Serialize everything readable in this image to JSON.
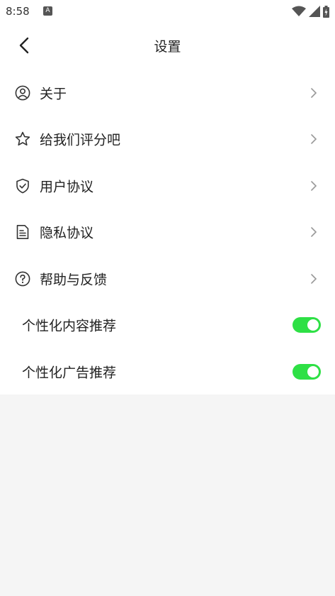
{
  "status_bar": {
    "time": "8:58",
    "notification_icon": "A"
  },
  "header": {
    "title": "设置"
  },
  "settings": {
    "items": [
      {
        "label": "关于",
        "icon": "person-circle-icon"
      },
      {
        "label": "给我们评分吧",
        "icon": "star-icon"
      },
      {
        "label": "用户协议",
        "icon": "shield-check-icon"
      },
      {
        "label": "隐私协议",
        "icon": "document-icon"
      },
      {
        "label": "帮助与反馈",
        "icon": "question-circle-icon"
      }
    ],
    "toggles": [
      {
        "label": "个性化内容推荐",
        "on": true
      },
      {
        "label": "个性化广告推荐",
        "on": true
      }
    ]
  },
  "colors": {
    "toggle_on": "#2ee045",
    "background": "#f5f5f5"
  }
}
